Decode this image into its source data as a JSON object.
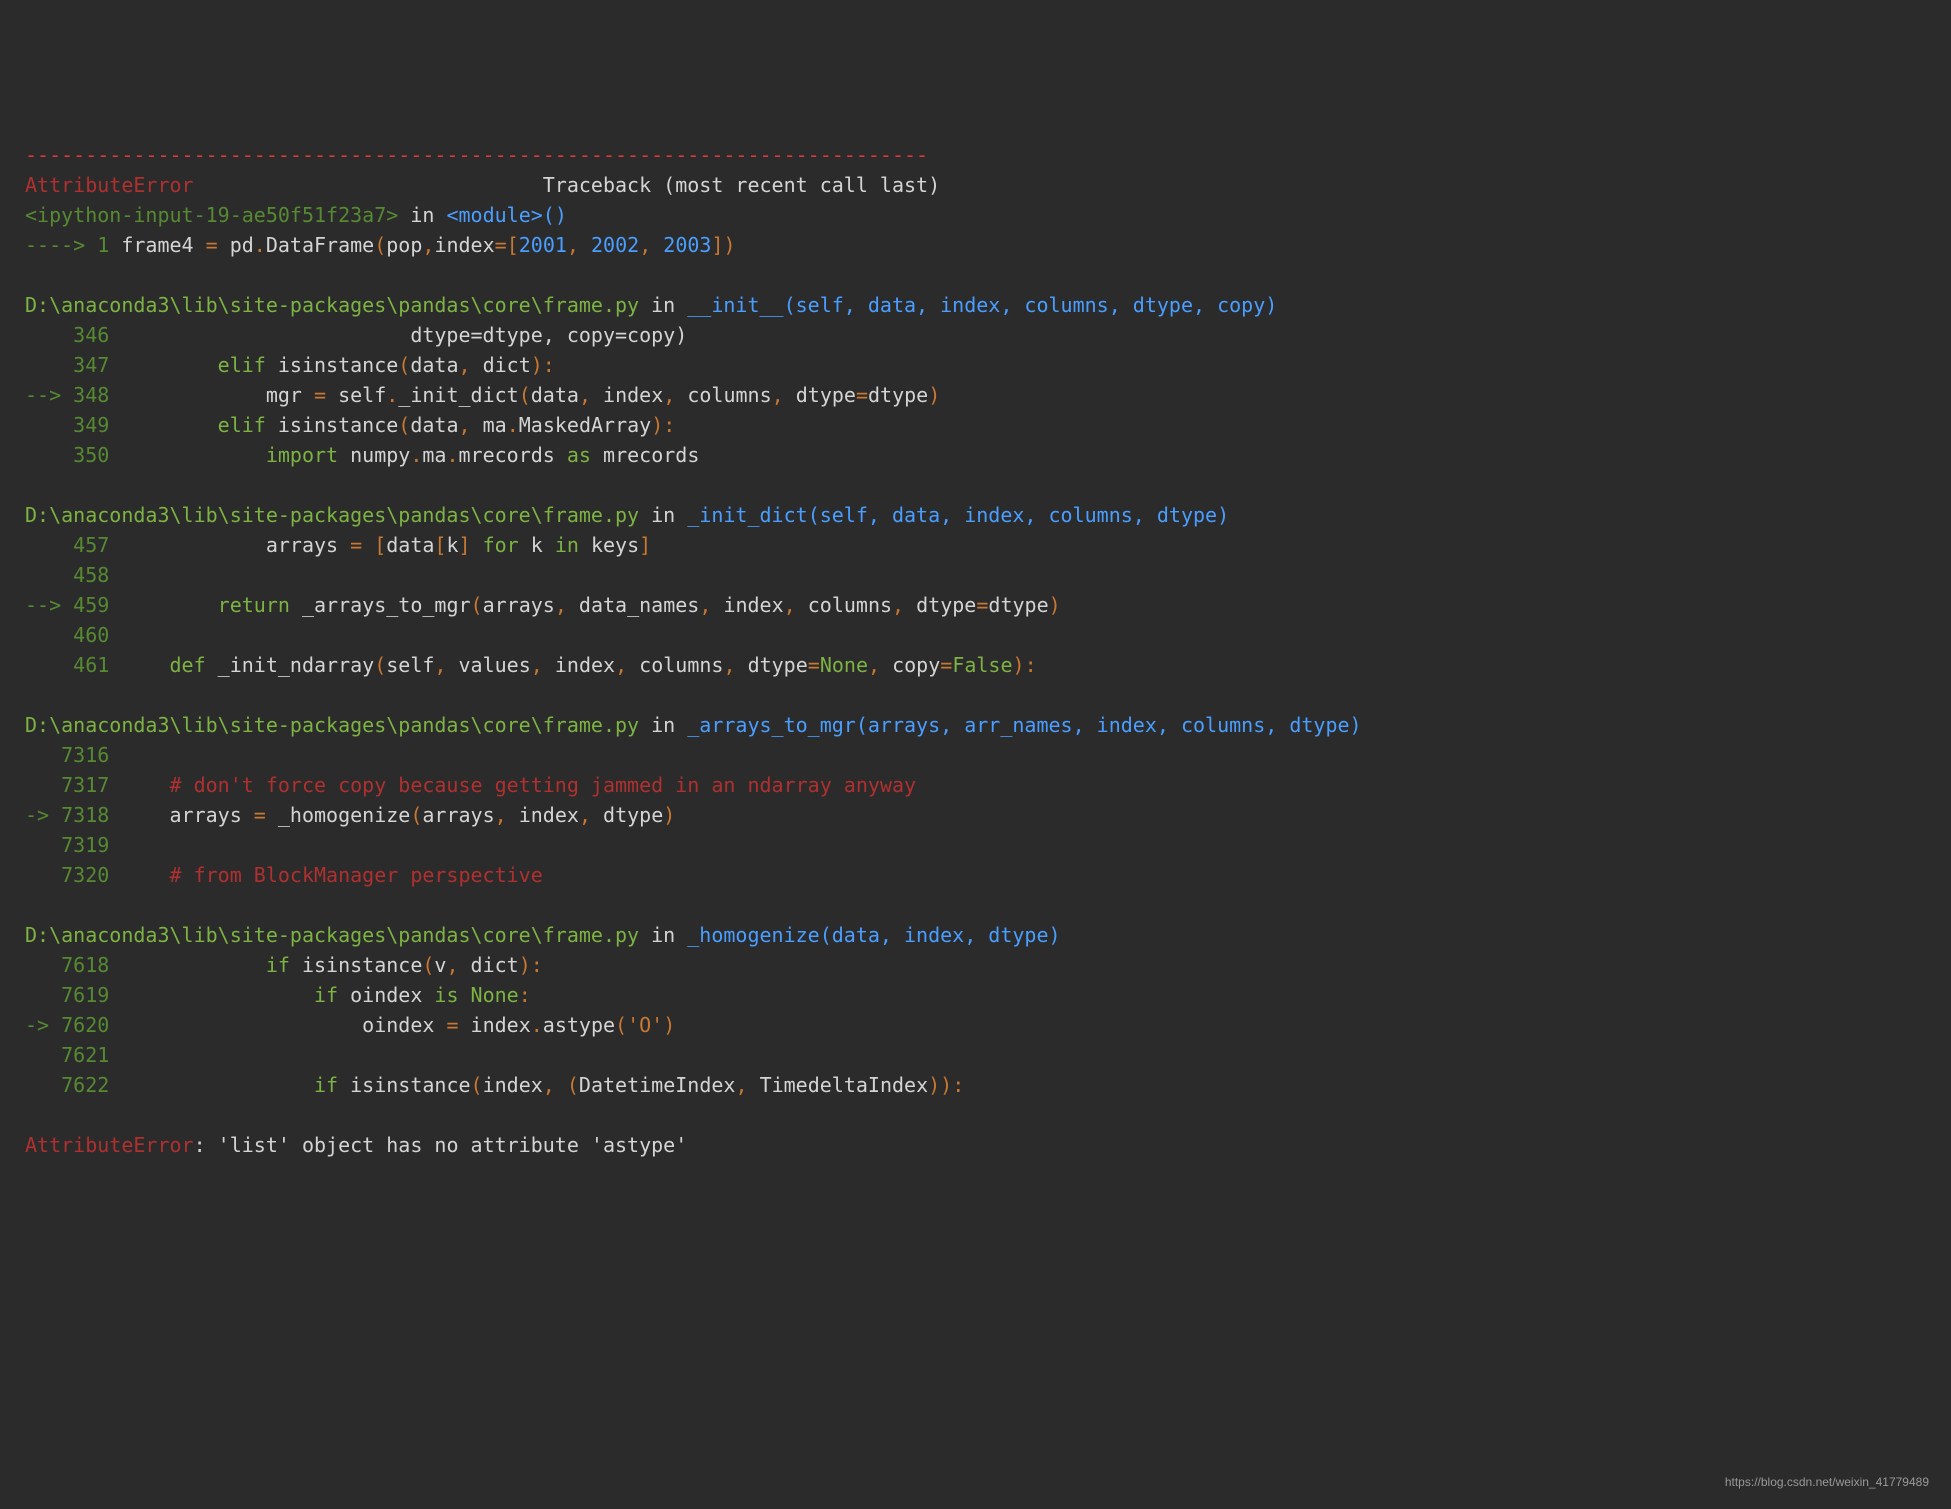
{
  "traceback": {
    "sep": "---------------------------------------------------------------------------",
    "error_type": "AttributeError",
    "header_text": "                             Traceback (most recent call last)",
    "ipython_input": "<ipython-input-19-ae50f51f23a7>",
    "in_text": " in ",
    "module": "<module>",
    "parens": "()",
    "arrow1": "----> 1 ",
    "code1_a": "frame4 ",
    "code1_b": "=",
    "code1_c": " pd",
    "code1_d": ".",
    "code1_e": "DataFrame",
    "code1_f": "(",
    "code1_g": "pop",
    "code1_h": ",",
    "code1_i": "index",
    "code1_j": "=[",
    "code1_k": "2001",
    "code1_l": ", ",
    "code1_m": "2002",
    "code1_n": ", ",
    "code1_o": "2003",
    "code1_p": "])"
  },
  "frame1": {
    "path": "D:\\anaconda3\\lib\\site-packages\\pandas\\core\\frame.py",
    "func": "__init__",
    "sig": "(self, data, index, columns, dtype, copy)",
    "l346_n": "    346 ",
    "l346_t": "                        dtype=dtype, copy=copy)",
    "l347_n": "    347 ",
    "l347_a": "        elif",
    "l347_b": " isinstance",
    "l347_c": "(",
    "l347_d": "data",
    "l347_e": ", ",
    "l347_f": "dict",
    "l347_g": "):",
    "l348_n": "--> 348 ",
    "l348_a": "            mgr ",
    "l348_b": "=",
    "l348_c": " self",
    "l348_d": ".",
    "l348_e": "_init_dict",
    "l348_f": "(",
    "l348_g": "data",
    "l348_h": ", ",
    "l348_i": "index",
    "l348_j": ", ",
    "l348_k": "columns",
    "l348_l": ", ",
    "l348_m": "dtype",
    "l348_n2": "=",
    "l348_o": "dtype",
    "l348_p": ")",
    "l349_n": "    349 ",
    "l349_a": "        elif",
    "l349_b": " isinstance",
    "l349_c": "(",
    "l349_d": "data",
    "l349_e": ", ",
    "l349_f": "ma",
    "l349_g": ".",
    "l349_h": "MaskedArray",
    "l349_i": "):",
    "l350_n": "    350 ",
    "l350_a": "            import",
    "l350_b": " numpy",
    "l350_c": ".",
    "l350_d": "ma",
    "l350_e": ".",
    "l350_f": "mrecords ",
    "l350_g": "as",
    "l350_h": " mrecords"
  },
  "frame2": {
    "path": "D:\\anaconda3\\lib\\site-packages\\pandas\\core\\frame.py",
    "func": "_init_dict",
    "sig": "(self, data, index, columns, dtype)",
    "l457_n": "    457 ",
    "l457_a": "            arrays ",
    "l457_b": "= [",
    "l457_c": "data",
    "l457_d": "[",
    "l457_e": "k",
    "l457_f": "] ",
    "l457_g": "for",
    "l457_h": " k ",
    "l457_i": "in",
    "l457_j": " keys",
    "l457_k": "]",
    "l458_n": "    458 ",
    "l459_n": "--> 459 ",
    "l459_a": "        return",
    "l459_b": " _arrays_to_mgr",
    "l459_c": "(",
    "l459_d": "arrays",
    "l459_e": ", ",
    "l459_f": "data_names",
    "l459_g": ", ",
    "l459_h": "index",
    "l459_i": ", ",
    "l459_j": "columns",
    "l459_k": ", ",
    "l459_l": "dtype",
    "l459_m": "=",
    "l459_o": "dtype",
    "l459_p": ")",
    "l460_n": "    460 ",
    "l461_n": "    461 ",
    "l461_a": "    def",
    "l461_b": " _init_ndarray",
    "l461_c": "(",
    "l461_d": "self",
    "l461_e": ", ",
    "l461_f": "values",
    "l461_g": ", ",
    "l461_h": "index",
    "l461_i": ", ",
    "l461_j": "columns",
    "l461_k": ", ",
    "l461_l": "dtype",
    "l461_m": "=",
    "l461_n2": "None",
    "l461_o": ", ",
    "l461_p": "copy",
    "l461_q": "=",
    "l461_r": "False",
    "l461_s": "):"
  },
  "frame3": {
    "path": "D:\\anaconda3\\lib\\site-packages\\pandas\\core\\frame.py",
    "func": "_arrays_to_mgr",
    "sig": "(arrays, arr_names, index, columns, dtype)",
    "l7316_n": "   7316 ",
    "l7317_n": "   7317 ",
    "l7317_t": "    # don't force copy because getting jammed in an ndarray anyway",
    "l7318_n": "-> 7318 ",
    "l7318_a": "    arrays ",
    "l7318_b": "=",
    "l7318_c": " _homogenize",
    "l7318_d": "(",
    "l7318_e": "arrays",
    "l7318_f": ", ",
    "l7318_g": "index",
    "l7318_h": ", ",
    "l7318_i": "dtype",
    "l7318_j": ")",
    "l7319_n": "   7319 ",
    "l7320_n": "   7320 ",
    "l7320_t": "    # from BlockManager perspective"
  },
  "frame4": {
    "path": "D:\\anaconda3\\lib\\site-packages\\pandas\\core\\frame.py",
    "func": "_homogenize",
    "sig": "(data, index, dtype)",
    "l7618_n": "   7618 ",
    "l7618_a": "            if",
    "l7618_b": " isinstance",
    "l7618_c": "(",
    "l7618_d": "v",
    "l7618_e": ", ",
    "l7618_f": "dict",
    "l7618_g": "):",
    "l7619_n": "   7619 ",
    "l7619_a": "                if",
    "l7619_b": " oindex ",
    "l7619_c": "is",
    "l7619_d": " None",
    "l7619_e": ":",
    "l7620_n": "-> 7620 ",
    "l7620_a": "                    oindex ",
    "l7620_b": "=",
    "l7620_c": " index",
    "l7620_d": ".",
    "l7620_e": "astype",
    "l7620_f": "(",
    "l7620_g": "'O'",
    "l7620_h": ")",
    "l7621_n": "   7621 ",
    "l7622_n": "   7622 ",
    "l7622_a": "                if",
    "l7622_b": " isinstance",
    "l7622_c": "(",
    "l7622_d": "index",
    "l7622_e": ", (",
    "l7622_f": "DatetimeIndex",
    "l7622_g": ", ",
    "l7622_h": "TimedeltaIndex",
    "l7622_i": ")):"
  },
  "final_error": {
    "type": "AttributeError",
    "msg": ": 'list' object has no attribute 'astype'"
  },
  "watermark": "https://blog.csdn.net/weixin_41779489"
}
